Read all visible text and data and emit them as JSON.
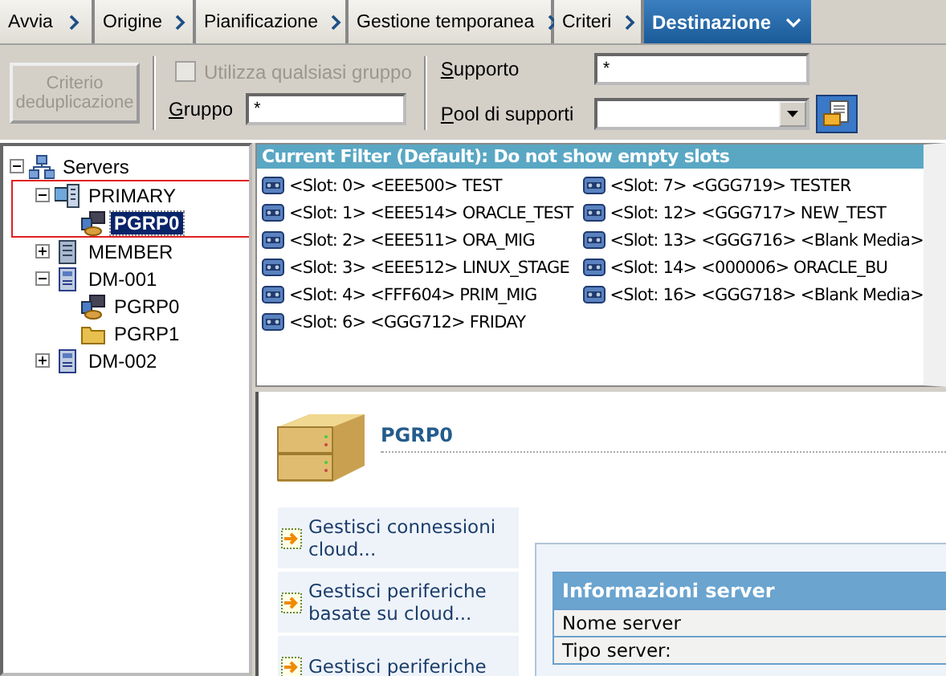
{
  "tabs": [
    {
      "label": "Avvia",
      "selected": false
    },
    {
      "label": "Origine",
      "selected": false
    },
    {
      "label": "Pianificazione",
      "selected": false
    },
    {
      "label": "Gestione temporanea",
      "selected": false
    },
    {
      "label": "Criteri",
      "selected": false
    },
    {
      "label": "Destinazione",
      "selected": true
    }
  ],
  "toolbar": {
    "dedup_button": {
      "label": "Criterio deduplicazione",
      "disabled": true
    },
    "any_group": {
      "label": "Utilizza qualsiasi gruppo",
      "checked": false,
      "disabled": true
    },
    "group": {
      "label": "Gruppo",
      "value": "*"
    },
    "media": {
      "label": "Supporto",
      "value": "*"
    },
    "media_pool": {
      "label": "Pool di supporti"
    }
  },
  "tree": [
    {
      "label": "Servers",
      "kind": "servers",
      "expanded": true,
      "selected": false,
      "children": [
        {
          "label": "PRIMARY",
          "kind": "primary",
          "expanded": true,
          "selected": false,
          "highlighted": true,
          "children": [
            {
              "label": "PGRP0",
              "kind": "device-group",
              "selected": true
            }
          ]
        },
        {
          "label": "MEMBER",
          "kind": "member",
          "expanded": false,
          "selected": false
        },
        {
          "label": "DM-001",
          "kind": "dm",
          "expanded": true,
          "selected": false,
          "children": [
            {
              "label": "PGRP0",
              "kind": "device-group",
              "selected": false
            },
            {
              "label": "PGRP1",
              "kind": "folder",
              "selected": false
            }
          ]
        },
        {
          "label": "DM-002",
          "kind": "dm",
          "expanded": false,
          "selected": false
        }
      ]
    }
  ],
  "slots": {
    "filter": "Current Filter (Default):  Do not show empty slots",
    "columns": [
      [
        "<Slot:  0> <EEE500> TEST",
        "<Slot:  1> <EEE514> ORACLE_TEST",
        "<Slot:  2> <EEE511> ORA_MIG",
        "<Slot:  3> <EEE512> LINUX_STAGE",
        "<Slot:  4> <FFF604> PRIM_MIG",
        "<Slot:  6> <GGG712> FRIDAY"
      ],
      [
        "<Slot:  7> <GGG719> TESTER",
        "<Slot: 12> <GGG717> NEW_TEST",
        "<Slot: 13> <GGG716> <Blank Media>",
        "<Slot: 14> <000006> ORACLE_BU",
        "<Slot: 16> <GGG718> <Blank Media>"
      ]
    ]
  },
  "detail": {
    "title": "PGRP0",
    "links": [
      "Gestisci connessioni cloud...",
      "Gestisci periferiche basate su cloud...",
      "Gestisci periferiche"
    ],
    "info": {
      "title": "Informazioni server",
      "rows": [
        "Nome server",
        "Tipo server:"
      ]
    }
  }
}
